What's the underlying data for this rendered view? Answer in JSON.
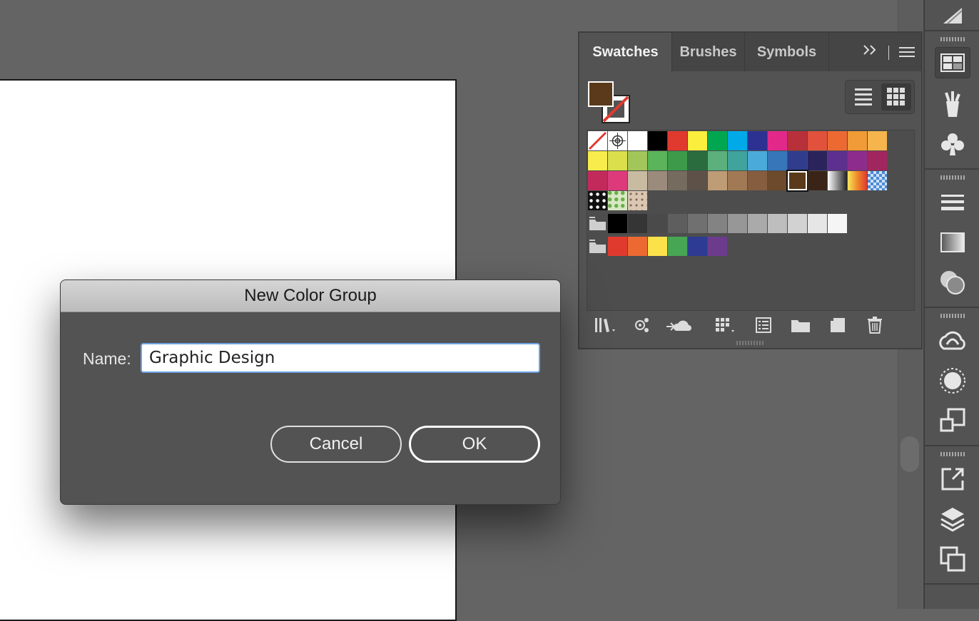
{
  "panel": {
    "tabs": [
      {
        "label": "Swatches"
      },
      {
        "label": "Brushes"
      },
      {
        "label": "Symbols"
      }
    ],
    "colors": {
      "fill": "#5a3a1a",
      "row1": [
        "none",
        "registration",
        "#ffffff",
        "#000000",
        "#e03a2f",
        "#fcee3c",
        "#00a650",
        "#00a9e8",
        "#2d3191",
        "#e2298a",
        "#b7303a",
        "#e2513c",
        "#ec6a32",
        "#f19a38",
        "#f5b54c"
      ],
      "row2": [
        "#f7ec4c",
        "#dadf4b",
        "#a2c65a",
        "#5bb35a",
        "#3d9a4b",
        "#2a6c3e",
        "#5bb07c",
        "#40a39d",
        "#4aabdb",
        "#3776b9",
        "#2f3d8c",
        "#2a235c",
        "#5d2f8e",
        "#8e2c8c",
        "#a1255f"
      ],
      "row3": [
        "#c22a5b",
        "#dc3a7b",
        "#c9bba2",
        "#9a8b7c",
        "#766b5f",
        "#5d5148",
        "#bd9c76",
        "#a17a55",
        "#865d3f",
        "#6c4a2b",
        "#5a3a1a",
        "#3a2418",
        "gradient-bw",
        "gradient-warm",
        "checker-blue"
      ],
      "row4": [
        "pattern-dots",
        "pattern-leaves",
        "pattern-swirls"
      ],
      "grays": [
        "#000000",
        "#353535",
        "#4a4a4a",
        "#5e5e5e",
        "#707070",
        "#838383",
        "#979797",
        "#aaaaaa",
        "#bebebe",
        "#d2d2d2",
        "#e6e6e6",
        "#f5f5f5"
      ],
      "group": [
        "#e03a2f",
        "#ec6a32",
        "#fce24a",
        "#47a653",
        "#2d3b92",
        "#6c3b8c"
      ]
    }
  },
  "dialog": {
    "title": "New Color Group",
    "name_label": "Name:",
    "name_value": "Graphic Design",
    "cancel_label": "Cancel",
    "ok_label": "OK"
  }
}
